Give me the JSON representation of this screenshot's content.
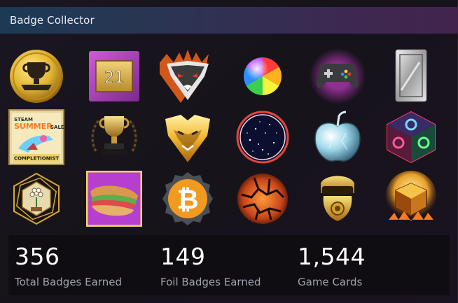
{
  "header": {
    "title": "Badge Collector"
  },
  "badges": [
    {
      "name": "trophy-medal-icon",
      "label": ""
    },
    {
      "name": "level-21-badge-icon",
      "label": "21"
    },
    {
      "name": "wolf-fire-badge-icon",
      "label": ""
    },
    {
      "name": "rainbow-orb-badge-icon",
      "label": ""
    },
    {
      "name": "gamepad-badge-icon",
      "label": ""
    },
    {
      "name": "silver-card-badge-icon",
      "label": ""
    },
    {
      "name": "steam-summer-sale-badge-icon",
      "label": "STEAM SUMMER SALE COMPLETIONIST",
      "line1": "STEAM",
      "line2": "SUMMER",
      "line3": "SALE",
      "line4": "COMPLETIONIST"
    },
    {
      "name": "gold-trophy-laurel-badge-icon",
      "label": ""
    },
    {
      "name": "gold-bear-badge-icon",
      "label": ""
    },
    {
      "name": "starry-portal-badge-icon",
      "label": ""
    },
    {
      "name": "crystal-apple-badge-icon",
      "label": ""
    },
    {
      "name": "neon-cube-badge-icon",
      "label": ""
    },
    {
      "name": "flower-hexagon-badge-icon",
      "label": ""
    },
    {
      "name": "sandwich-badge-icon",
      "label": ""
    },
    {
      "name": "bitcoin-badge-icon",
      "label": ""
    },
    {
      "name": "lava-orb-badge-icon",
      "label": ""
    },
    {
      "name": "gas-mask-badge-icon",
      "label": ""
    },
    {
      "name": "glowing-cube-badge-icon",
      "label": ""
    }
  ],
  "stats": [
    {
      "value": "356",
      "label": "Total Badges Earned"
    },
    {
      "value": "149",
      "label": "Foil Badges Earned"
    },
    {
      "value": "1,544",
      "label": "Game Cards"
    }
  ]
}
